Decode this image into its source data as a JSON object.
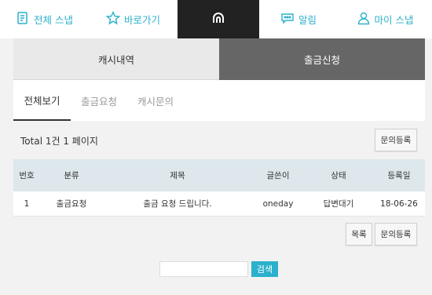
{
  "nav": {
    "all_snap": "전체 스냅",
    "shortcut": "바로가기",
    "alarm": "알림",
    "my_snap": "마이 스냅"
  },
  "segments": {
    "cash_history": "캐시내역",
    "withdraw_apply": "출금신청"
  },
  "subtabs": [
    "전체보기",
    "출금요청",
    "캐시문의"
  ],
  "total": "Total 1건 1 페이지",
  "buttons": {
    "inquiry_register": "문의등록",
    "list": "목록",
    "search": "검색"
  },
  "table": {
    "headers": [
      "번호",
      "분류",
      "제목",
      "글쓴이",
      "상태",
      "등록일"
    ],
    "rows": [
      [
        "1",
        "출금요청",
        "출금 요청 드립니다.",
        "oneday",
        "답변대기",
        "18-06-26"
      ]
    ]
  },
  "search": {
    "value": ""
  },
  "colors": {
    "accent": "#2bb1cc",
    "dark": "#222222",
    "segment_active": "#666666"
  }
}
